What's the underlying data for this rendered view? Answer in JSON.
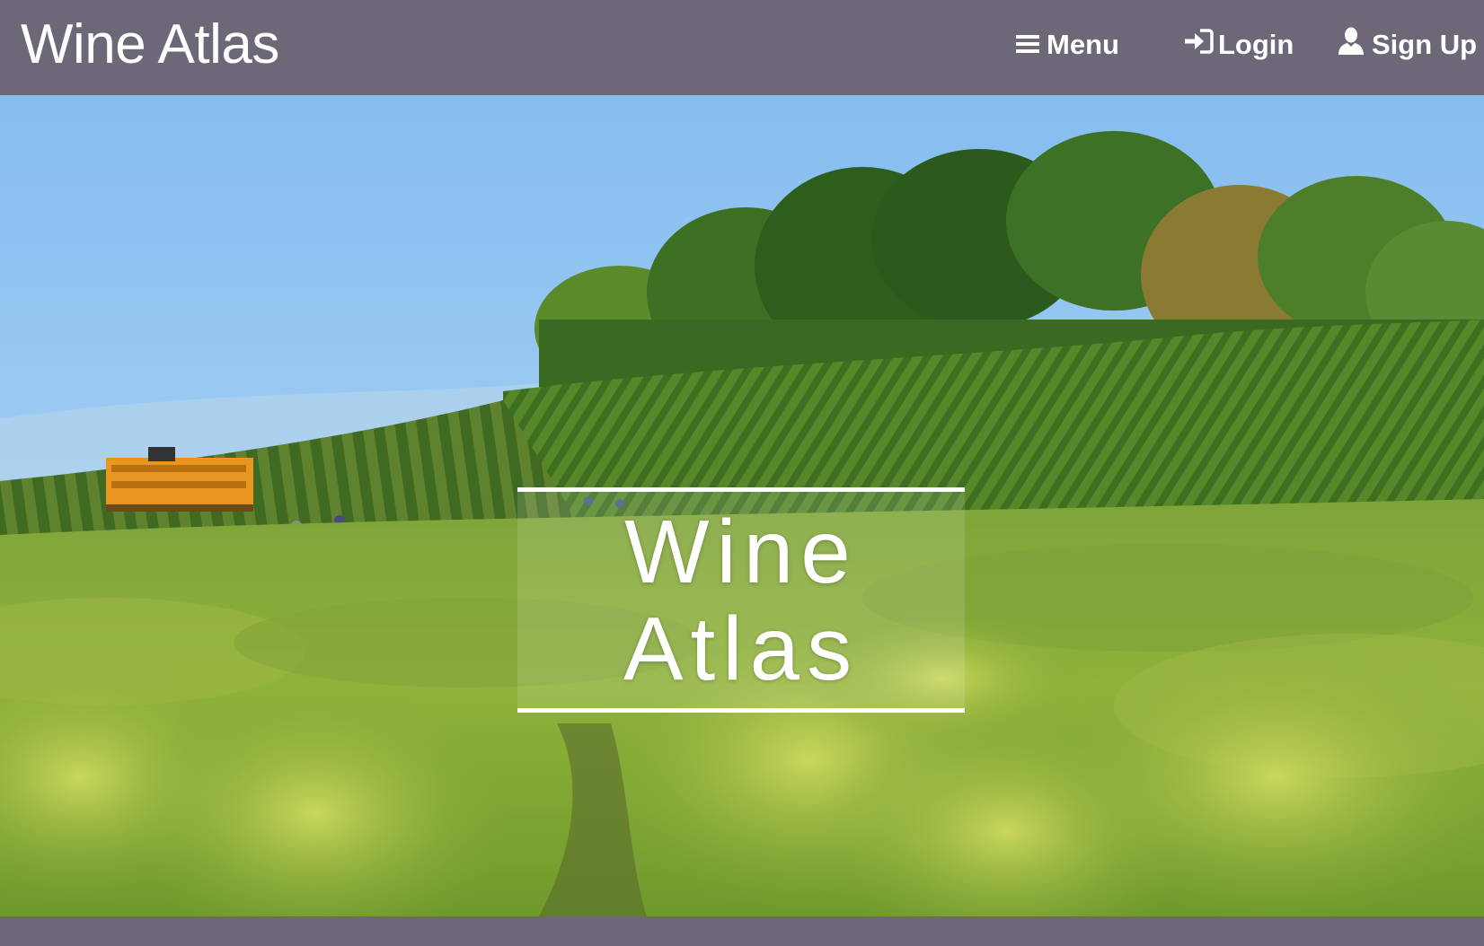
{
  "navbar": {
    "brand": "Wine Atlas",
    "menu_label": "Menu",
    "login_label": "Login",
    "signup_label": "Sign Up",
    "menu_icon": "hamburger-icon",
    "login_icon": "login-arrow-icon",
    "signup_icon": "user-icon",
    "background_color": "#6e6778",
    "text_color": "#ffffff"
  },
  "hero": {
    "image_subject": "vineyard-rows-with-trees-and-harvest-tractor",
    "title_line1": "Wine",
    "title_line2": "Atlas",
    "title_color": "#ffffff"
  },
  "footer": {
    "background_color": "#6e6778"
  }
}
